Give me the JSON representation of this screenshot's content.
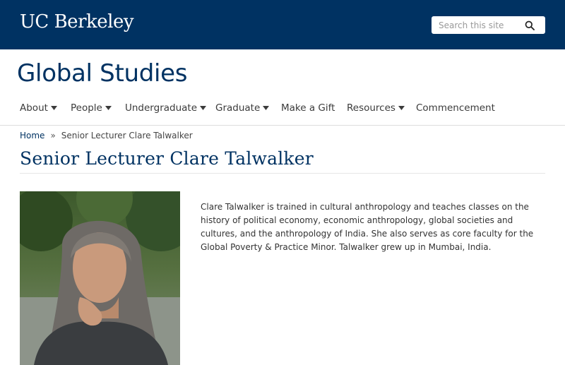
{
  "header": {
    "brand": "UC Berkeley",
    "search_placeholder": "Search this site"
  },
  "site": {
    "title": "Global Studies"
  },
  "nav": {
    "items": [
      {
        "label": "About",
        "has_dropdown": true
      },
      {
        "label": "People",
        "has_dropdown": true
      },
      {
        "label": "Undergraduate",
        "has_dropdown": true
      },
      {
        "label": "Graduate",
        "has_dropdown": true
      },
      {
        "label": "Make a Gift",
        "has_dropdown": false
      },
      {
        "label": "Resources",
        "has_dropdown": true
      },
      {
        "label": "Commencement",
        "has_dropdown": false
      }
    ]
  },
  "breadcrumb": {
    "home": "Home",
    "separator": "»",
    "current": "Senior Lecturer Clare Talwalker"
  },
  "page": {
    "title": "Senior Lecturer Clare Talwalker",
    "bio": "Clare Talwalker is trained in cultural anthropology and teaches classes on the history of political economy, economic anthropology, global societies and cultures, and the anthropology of India. She also serves as core faculty for the Global Poverty & Practice Minor. Talwalker grew up in Mumbai, India."
  },
  "colors": {
    "brand_navy": "#003262",
    "nav_text": "#3b3b3b",
    "rule": "#dddddd"
  },
  "icons": {
    "search": "magnifier-icon",
    "caret": "caret-down-icon"
  }
}
